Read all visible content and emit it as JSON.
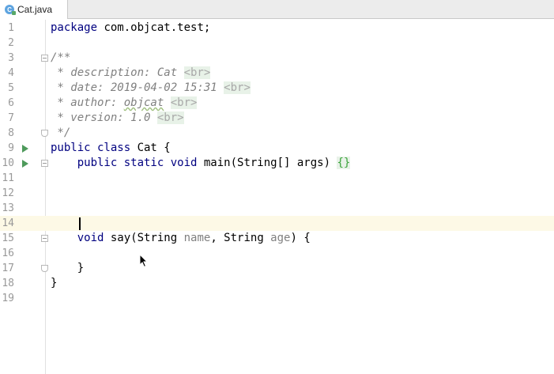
{
  "tab": {
    "filename": "Cat.java",
    "icon": "java-class-icon",
    "icon_letter": "C"
  },
  "editor": {
    "current_line": 14,
    "lines": [
      {
        "n": "1",
        "parts": [
          [
            "kw",
            "package "
          ],
          [
            "plain",
            "com.objcat.test;"
          ]
        ]
      },
      {
        "n": "2",
        "parts": []
      },
      {
        "n": "3",
        "parts": [
          [
            "comment",
            "/**"
          ]
        ]
      },
      {
        "n": "4",
        "parts": [
          [
            "comment",
            " * description: Cat "
          ],
          [
            "tag",
            "<br>"
          ]
        ]
      },
      {
        "n": "5",
        "parts": [
          [
            "comment",
            " * date: 2019-04-02 15:31 "
          ],
          [
            "tag",
            "<br>"
          ]
        ]
      },
      {
        "n": "6",
        "parts": [
          [
            "comment",
            " * author: "
          ],
          [
            "comment squig",
            "objcat"
          ],
          [
            "comment",
            " "
          ],
          [
            "tag",
            "<br>"
          ]
        ]
      },
      {
        "n": "7",
        "parts": [
          [
            "comment",
            " * version: 1.0 "
          ],
          [
            "tag",
            "<br>"
          ]
        ]
      },
      {
        "n": "8",
        "parts": [
          [
            "comment",
            " */"
          ]
        ]
      },
      {
        "n": "9",
        "parts": [
          [
            "kw",
            "public class "
          ],
          [
            "plain",
            "Cat {"
          ]
        ]
      },
      {
        "n": "10",
        "parts": [
          [
            "plain",
            "    "
          ],
          [
            "kw",
            "public static void "
          ],
          [
            "plain",
            "main(String[] args) "
          ],
          [
            "brace",
            "{}"
          ]
        ]
      },
      {
        "n": "11",
        "parts": []
      },
      {
        "n": "12",
        "parts": []
      },
      {
        "n": "13",
        "parts": []
      },
      {
        "n": "14",
        "parts": []
      },
      {
        "n": "15",
        "parts": [
          [
            "plain",
            "    "
          ],
          [
            "kw",
            "void "
          ],
          [
            "plain",
            "say(String "
          ],
          [
            "param",
            "name"
          ],
          [
            "plain",
            ", String "
          ],
          [
            "param",
            "age"
          ],
          [
            "plain",
            ") {"
          ]
        ]
      },
      {
        "n": "16",
        "parts": []
      },
      {
        "n": "17",
        "parts": [
          [
            "plain",
            "    }"
          ]
        ]
      },
      {
        "n": "18",
        "parts": [
          [
            "plain",
            "}"
          ]
        ]
      },
      {
        "n": "19",
        "parts": []
      }
    ]
  }
}
